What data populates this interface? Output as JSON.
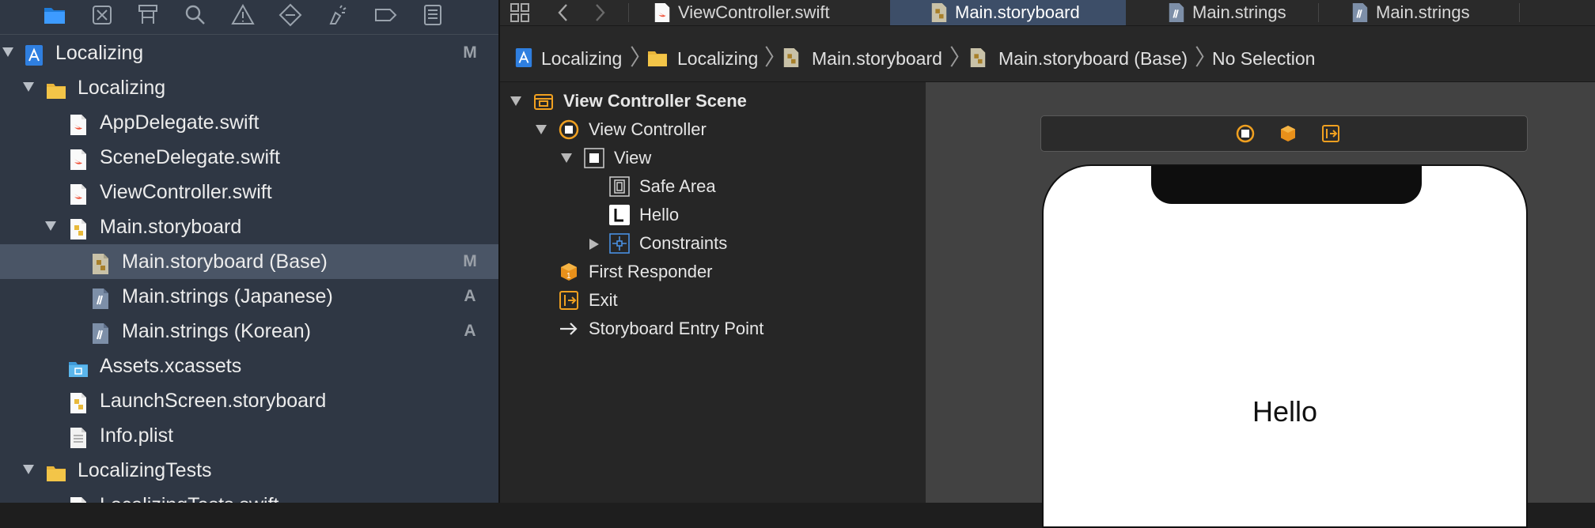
{
  "navigator": {
    "toolbar_icons": [
      "folder-icon",
      "source-control-icon",
      "hierarchy-icon",
      "search-icon",
      "warning-icon",
      "test-icon",
      "debug-icon",
      "breakpoint-icon",
      "report-icon"
    ],
    "tree": [
      {
        "label": "Localizing",
        "badge": "M",
        "icon": "project-icon",
        "expanded": true
      },
      {
        "label": "Localizing",
        "badge": "",
        "icon": "folder-icon",
        "expanded": true
      },
      {
        "label": "AppDelegate.swift",
        "badge": "",
        "icon": "swift-file-icon"
      },
      {
        "label": "SceneDelegate.swift",
        "badge": "",
        "icon": "swift-file-icon"
      },
      {
        "label": "ViewController.swift",
        "badge": "",
        "icon": "swift-file-icon"
      },
      {
        "label": "Main.storyboard",
        "badge": "",
        "icon": "storyboard-icon",
        "expanded": true
      },
      {
        "label": "Main.storyboard (Base)",
        "badge": "M",
        "icon": "storyboard-icon",
        "selected": true
      },
      {
        "label": "Main.strings (Japanese)",
        "badge": "A",
        "icon": "strings-file-icon"
      },
      {
        "label": "Main.strings (Korean)",
        "badge": "A",
        "icon": "strings-file-icon"
      },
      {
        "label": "Assets.xcassets",
        "badge": "",
        "icon": "asset-catalog-icon"
      },
      {
        "label": "LaunchScreen.storyboard",
        "badge": "",
        "icon": "storyboard-icon"
      },
      {
        "label": "Info.plist",
        "badge": "",
        "icon": "plist-icon"
      },
      {
        "label": "LocalizingTests",
        "badge": "",
        "icon": "folder-icon",
        "expanded": true
      },
      {
        "label": "LocalizingTests.swift",
        "badge": "",
        "icon": "swift-file-icon"
      }
    ]
  },
  "tabs": [
    {
      "label": "ViewController.swift",
      "icon": "swift-file-icon"
    },
    {
      "label": "Main.storyboard",
      "icon": "storyboard-icon",
      "active": true
    },
    {
      "label": "Main.strings",
      "icon": "strings-file-icon"
    },
    {
      "label": "Main.strings",
      "icon": "strings-file-icon"
    }
  ],
  "jumpbar": {
    "crumbs": [
      "Localizing",
      "Localizing",
      "Main.storyboard",
      "Main.storyboard (Base)",
      "No Selection"
    ]
  },
  "outline": {
    "items": [
      {
        "label": "View Controller Scene",
        "icon": "scene-icon"
      },
      {
        "label": "View Controller",
        "icon": "view-controller-icon"
      },
      {
        "label": "View",
        "icon": "view-icon"
      },
      {
        "label": "Safe Area",
        "icon": "safe-area-icon"
      },
      {
        "label": "Hello",
        "icon": "label-icon"
      },
      {
        "label": "Constraints",
        "icon": "constraints-icon"
      },
      {
        "label": "First Responder",
        "icon": "first-responder-icon"
      },
      {
        "label": "Exit",
        "icon": "exit-icon"
      },
      {
        "label": "Storyboard Entry Point",
        "icon": "arrow-right-icon"
      }
    ]
  },
  "canvas": {
    "scene_icons": [
      "view-controller-icon",
      "first-responder-icon",
      "exit-icon"
    ],
    "label_text": "Hello"
  },
  "colors": {
    "navigator_bg": "#2f3744",
    "selection": "#4a5566",
    "active_tab": "#3d4e68",
    "accent_orange": "#f0a020",
    "swift_orange": "#f05138",
    "folder_yellow": "#f3c548"
  }
}
